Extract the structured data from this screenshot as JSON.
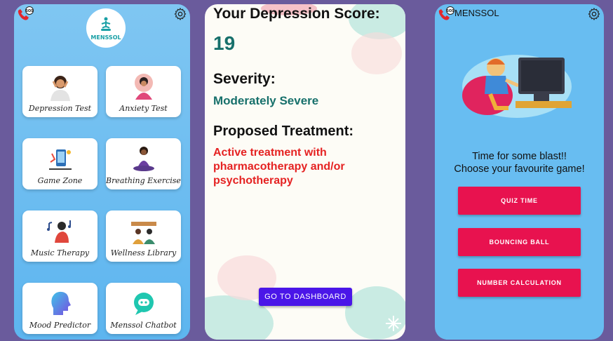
{
  "dashboard": {
    "logo_text": "MENSSOL",
    "tiles": [
      {
        "label": "Depression Test"
      },
      {
        "label": "Anxiety Test"
      },
      {
        "label": "Game Zone"
      },
      {
        "label": "Breathing Exercise"
      },
      {
        "label": "Music Therapy"
      },
      {
        "label": "Wellness Library"
      },
      {
        "label": "Mood Predictor"
      },
      {
        "label": "Menssol Chatbot"
      }
    ]
  },
  "result": {
    "score_title": "Your Depression Score:",
    "score_value": "19",
    "severity_title": "Severity:",
    "severity_value": "Moderately Severe",
    "treatment_title": "Proposed Treatment:",
    "treatment_value": "Active treatment with pharmacotherapy and/or psychotherapy",
    "button_label": "GO TO DASHBOARD"
  },
  "games": {
    "app_title": "MENSSOL",
    "text_line1": "Time for some blast!!",
    "text_line2": "Choose your favourite game!",
    "buttons": [
      {
        "label": "QUIZ TIME"
      },
      {
        "label": "BOUNCING BALL"
      },
      {
        "label": "NUMBER CALCULATION"
      }
    ]
  },
  "colors": {
    "background": "#6a5b9c",
    "sky": "#68bdf1",
    "teal": "#17706b",
    "red_text": "#e52222",
    "dashboard_button": "#4a16e8",
    "game_button": "#e8124f"
  }
}
